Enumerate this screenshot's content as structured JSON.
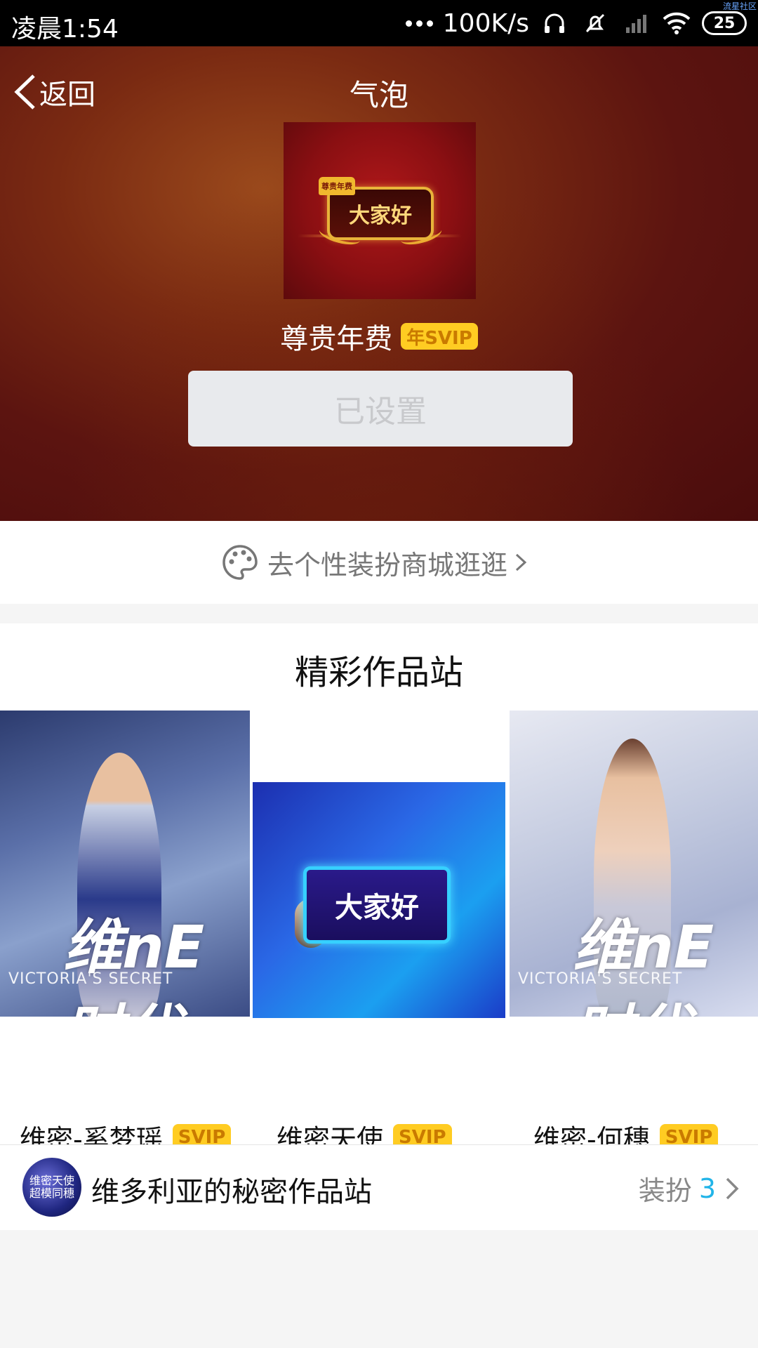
{
  "status_bar": {
    "time": "凌晨1:54",
    "speed": "100K/s",
    "battery": "25",
    "corner_tag": "流星社区"
  },
  "header": {
    "back_label": "返回",
    "title": "气泡",
    "preview_bubble_text": "大家好",
    "preview_crown_text": "尊贵年费",
    "item_name": "尊贵年费",
    "item_badge": "年SVIP",
    "set_button_label": "已设置"
  },
  "shop_link": {
    "label": "去个性装扮商城逛逛"
  },
  "works": {
    "title": "精彩作品站",
    "cards": [
      {
        "name": "维密-奚梦瑶",
        "badge": "SVIP",
        "type": "名片",
        "overlay": "维nE时代",
        "brand": "VICTORIA'S SECRET"
      },
      {
        "name": "维密天使",
        "badge": "SVIP",
        "type": "气泡",
        "bubble_text": "大家好"
      },
      {
        "name": "维密-何穗",
        "badge": "SVIP",
        "type": "名片",
        "overlay": "维nE时代",
        "brand": "VICTORIA'S SECRET"
      }
    ]
  },
  "author": {
    "avatar_text": "维密天使\n超模同穗",
    "name": "维多利亚的秘密作品站",
    "count_label": "装扮",
    "count": "3"
  },
  "colors": {
    "badge_bg": "#ffcc22",
    "accent_blue": "#21b4e8",
    "header_red": "#5c1410"
  }
}
